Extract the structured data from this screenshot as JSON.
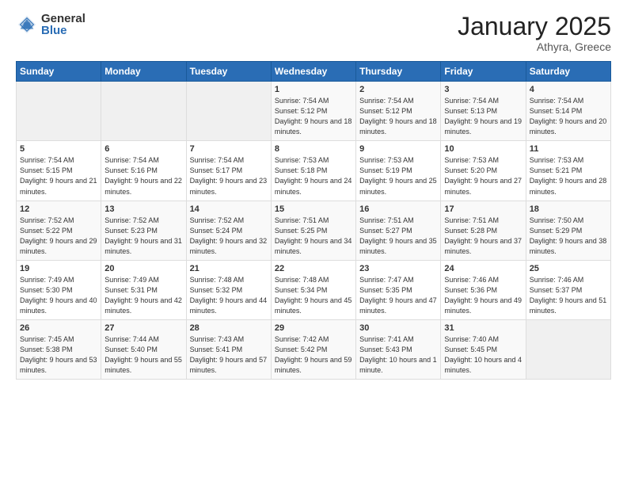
{
  "logo": {
    "general": "General",
    "blue": "Blue"
  },
  "title": "January 2025",
  "location": "Athyra, Greece",
  "days_of_week": [
    "Sunday",
    "Monday",
    "Tuesday",
    "Wednesday",
    "Thursday",
    "Friday",
    "Saturday"
  ],
  "weeks": [
    [
      {
        "day": "",
        "info": ""
      },
      {
        "day": "",
        "info": ""
      },
      {
        "day": "",
        "info": ""
      },
      {
        "day": "1",
        "info": "Sunrise: 7:54 AM\nSunset: 5:12 PM\nDaylight: 9 hours\nand 18 minutes."
      },
      {
        "day": "2",
        "info": "Sunrise: 7:54 AM\nSunset: 5:12 PM\nDaylight: 9 hours\nand 18 minutes."
      },
      {
        "day": "3",
        "info": "Sunrise: 7:54 AM\nSunset: 5:13 PM\nDaylight: 9 hours\nand 19 minutes."
      },
      {
        "day": "4",
        "info": "Sunrise: 7:54 AM\nSunset: 5:14 PM\nDaylight: 9 hours\nand 20 minutes."
      }
    ],
    [
      {
        "day": "5",
        "info": "Sunrise: 7:54 AM\nSunset: 5:15 PM\nDaylight: 9 hours\nand 21 minutes."
      },
      {
        "day": "6",
        "info": "Sunrise: 7:54 AM\nSunset: 5:16 PM\nDaylight: 9 hours\nand 22 minutes."
      },
      {
        "day": "7",
        "info": "Sunrise: 7:54 AM\nSunset: 5:17 PM\nDaylight: 9 hours\nand 23 minutes."
      },
      {
        "day": "8",
        "info": "Sunrise: 7:53 AM\nSunset: 5:18 PM\nDaylight: 9 hours\nand 24 minutes."
      },
      {
        "day": "9",
        "info": "Sunrise: 7:53 AM\nSunset: 5:19 PM\nDaylight: 9 hours\nand 25 minutes."
      },
      {
        "day": "10",
        "info": "Sunrise: 7:53 AM\nSunset: 5:20 PM\nDaylight: 9 hours\nand 27 minutes."
      },
      {
        "day": "11",
        "info": "Sunrise: 7:53 AM\nSunset: 5:21 PM\nDaylight: 9 hours\nand 28 minutes."
      }
    ],
    [
      {
        "day": "12",
        "info": "Sunrise: 7:52 AM\nSunset: 5:22 PM\nDaylight: 9 hours\nand 29 minutes."
      },
      {
        "day": "13",
        "info": "Sunrise: 7:52 AM\nSunset: 5:23 PM\nDaylight: 9 hours\nand 31 minutes."
      },
      {
        "day": "14",
        "info": "Sunrise: 7:52 AM\nSunset: 5:24 PM\nDaylight: 9 hours\nand 32 minutes."
      },
      {
        "day": "15",
        "info": "Sunrise: 7:51 AM\nSunset: 5:25 PM\nDaylight: 9 hours\nand 34 minutes."
      },
      {
        "day": "16",
        "info": "Sunrise: 7:51 AM\nSunset: 5:27 PM\nDaylight: 9 hours\nand 35 minutes."
      },
      {
        "day": "17",
        "info": "Sunrise: 7:51 AM\nSunset: 5:28 PM\nDaylight: 9 hours\nand 37 minutes."
      },
      {
        "day": "18",
        "info": "Sunrise: 7:50 AM\nSunset: 5:29 PM\nDaylight: 9 hours\nand 38 minutes."
      }
    ],
    [
      {
        "day": "19",
        "info": "Sunrise: 7:49 AM\nSunset: 5:30 PM\nDaylight: 9 hours\nand 40 minutes."
      },
      {
        "day": "20",
        "info": "Sunrise: 7:49 AM\nSunset: 5:31 PM\nDaylight: 9 hours\nand 42 minutes."
      },
      {
        "day": "21",
        "info": "Sunrise: 7:48 AM\nSunset: 5:32 PM\nDaylight: 9 hours\nand 44 minutes."
      },
      {
        "day": "22",
        "info": "Sunrise: 7:48 AM\nSunset: 5:34 PM\nDaylight: 9 hours\nand 45 minutes."
      },
      {
        "day": "23",
        "info": "Sunrise: 7:47 AM\nSunset: 5:35 PM\nDaylight: 9 hours\nand 47 minutes."
      },
      {
        "day": "24",
        "info": "Sunrise: 7:46 AM\nSunset: 5:36 PM\nDaylight: 9 hours\nand 49 minutes."
      },
      {
        "day": "25",
        "info": "Sunrise: 7:46 AM\nSunset: 5:37 PM\nDaylight: 9 hours\nand 51 minutes."
      }
    ],
    [
      {
        "day": "26",
        "info": "Sunrise: 7:45 AM\nSunset: 5:38 PM\nDaylight: 9 hours\nand 53 minutes."
      },
      {
        "day": "27",
        "info": "Sunrise: 7:44 AM\nSunset: 5:40 PM\nDaylight: 9 hours\nand 55 minutes."
      },
      {
        "day": "28",
        "info": "Sunrise: 7:43 AM\nSunset: 5:41 PM\nDaylight: 9 hours\nand 57 minutes."
      },
      {
        "day": "29",
        "info": "Sunrise: 7:42 AM\nSunset: 5:42 PM\nDaylight: 9 hours\nand 59 minutes."
      },
      {
        "day": "30",
        "info": "Sunrise: 7:41 AM\nSunset: 5:43 PM\nDaylight: 10 hours\nand 1 minute."
      },
      {
        "day": "31",
        "info": "Sunrise: 7:40 AM\nSunset: 5:45 PM\nDaylight: 10 hours\nand 4 minutes."
      },
      {
        "day": "",
        "info": ""
      }
    ]
  ]
}
